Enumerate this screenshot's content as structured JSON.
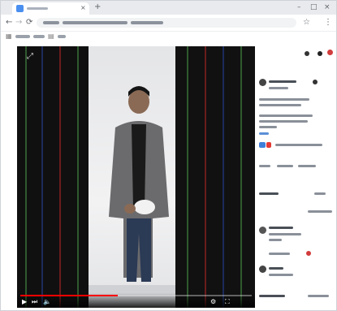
{
  "browser": {
    "tab_close": "×",
    "new_tab": "+",
    "window_controls": {
      "minimize": "–",
      "maximize": "□",
      "close": "×"
    },
    "nav_icons": {
      "back": "←",
      "forward": "→",
      "reload": "⟳"
    },
    "toolbar_icons": {
      "star": "☆",
      "menu": "⋮"
    },
    "bookmark_icons": {
      "apps": "▦",
      "folder": "▤"
    }
  },
  "player": {
    "corner_icon": "⤢",
    "progress": 0.42,
    "controls": {
      "play": "▶",
      "next": "⏭",
      "volume": "🔈",
      "settings": "⚙",
      "fullscreen": "⛶"
    },
    "colors": {
      "progress": "#ff0000",
      "stripe_green": "#2e5a2e",
      "stripe_red": "#6a1c1c",
      "stripe_blue": "#1c2a5a"
    }
  },
  "sidebar": {
    "icons": {
      "notifications": "●",
      "avatar": "●"
    },
    "accent_colors": {
      "like": "#e53935",
      "subscribe": "#3f7fd9"
    }
  }
}
